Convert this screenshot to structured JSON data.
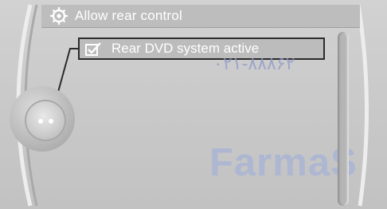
{
  "header": {
    "title": "Allow rear control",
    "icon": "gear-icon"
  },
  "menu": {
    "selected_item": {
      "label": "Rear DVD system active",
      "icon": "checkbox-checked-icon",
      "checked": true
    }
  },
  "controller": {
    "icon": "controller-knob-icon"
  },
  "watermarks": {
    "phone": "۰۲۱-۸۸۸۶۲",
    "brand": "FarmaS"
  },
  "colors": {
    "background": "#c9c9c9",
    "text": "#ffffff",
    "focus_border": "#2b2b2b"
  }
}
